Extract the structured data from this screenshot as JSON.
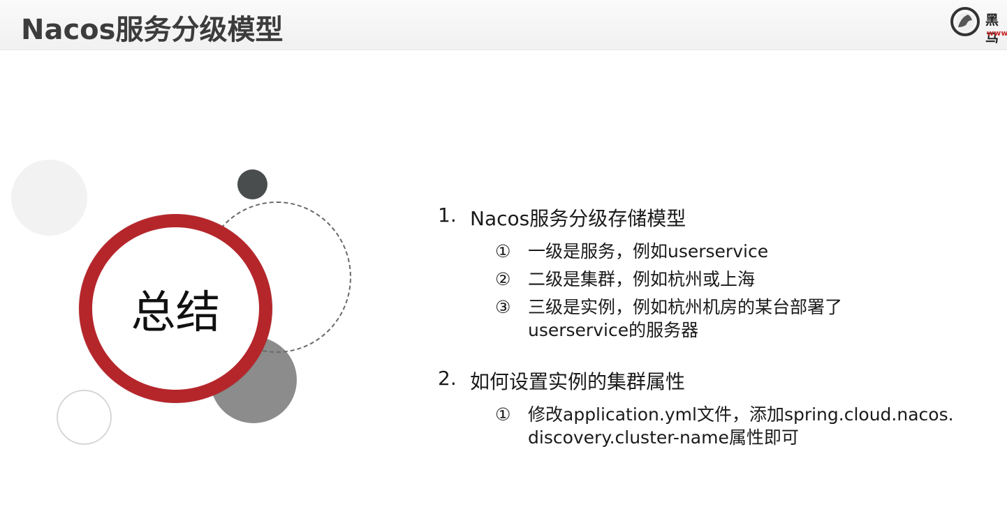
{
  "header": {
    "title": "Nacos服务分级模型",
    "logo_text": "黑马",
    "logo_sub": "www"
  },
  "badge": {
    "label": "总结"
  },
  "content": {
    "items": [
      {
        "number": "1.",
        "text": "Nacos服务分级存储模型",
        "subs": [
          {
            "mark": "①",
            "text": "一级是服务，例如userservice"
          },
          {
            "mark": "②",
            "text": "二级是集群，例如杭州或上海"
          },
          {
            "mark": "③",
            "text": "三级是实例，例如杭州机房的某台部署了userservice的服务器"
          }
        ]
      },
      {
        "number": "2.",
        "text": "如何设置实例的集群属性",
        "subs": [
          {
            "mark": "①",
            "text": "修改application.yml文件，添加spring.cloud.nacos.discovery.cluster-name属性即可"
          }
        ]
      }
    ]
  },
  "colors": {
    "accent_red": "#b5262b",
    "dark_gray": "#4a4d4e",
    "mid_gray": "#8c8c8c"
  }
}
